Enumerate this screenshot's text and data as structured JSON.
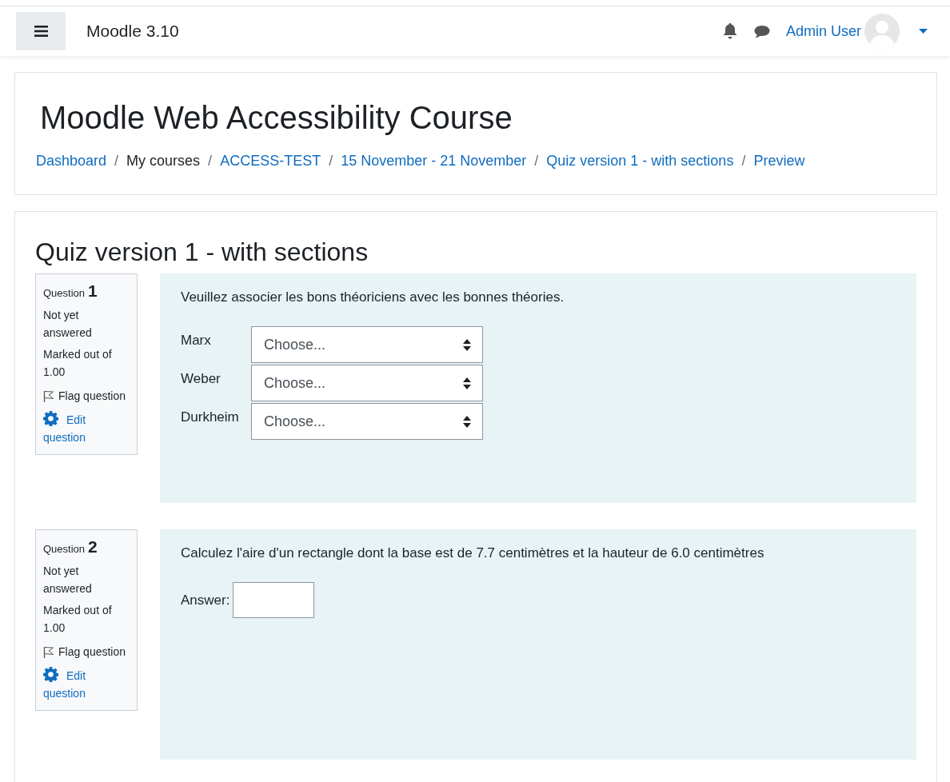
{
  "navbar": {
    "site_name": "Moodle 3.10",
    "user_name": "Admin User"
  },
  "header": {
    "title": "Moodle Web Accessibility Course",
    "breadcrumb_separator": "/",
    "breadcrumb": [
      {
        "label": "Dashboard",
        "kind": "link"
      },
      {
        "label": "My courses",
        "kind": "text"
      },
      {
        "label": "ACCESS-TEST",
        "kind": "link"
      },
      {
        "label": "15 November - 21 November",
        "kind": "link"
      },
      {
        "label": "Quiz version 1 - with sections",
        "kind": "link"
      },
      {
        "label": "Preview",
        "kind": "link"
      }
    ]
  },
  "quiz": {
    "title": "Quiz version 1 - with sections",
    "questions": [
      {
        "kind": "match",
        "label": "Question",
        "number": "1",
        "status": "Not yet answered",
        "marks": "Marked out of 1.00",
        "flag_label": "Flag question",
        "flagged": false,
        "edit_label": "Edit question",
        "text": "Veuillez associer les bons théoriciens avec les bonnes théories.",
        "rows": [
          {
            "term": "Marx",
            "value": "Choose..."
          },
          {
            "term": "Weber",
            "value": "Choose..."
          },
          {
            "term": "Durkheim",
            "value": "Choose..."
          }
        ]
      },
      {
        "kind": "numerical",
        "label": "Question",
        "number": "2",
        "status": "Not yet answered",
        "marks": "Marked out of 1.00",
        "flag_label": "Flag question",
        "flagged": false,
        "edit_label": "Edit question",
        "text": "Calculez l'aire d'un rectangle dont la base est de 7.7 centimètres et la hauteur de 6.0 centimètres",
        "answer_label": "Answer:"
      }
    ]
  }
}
